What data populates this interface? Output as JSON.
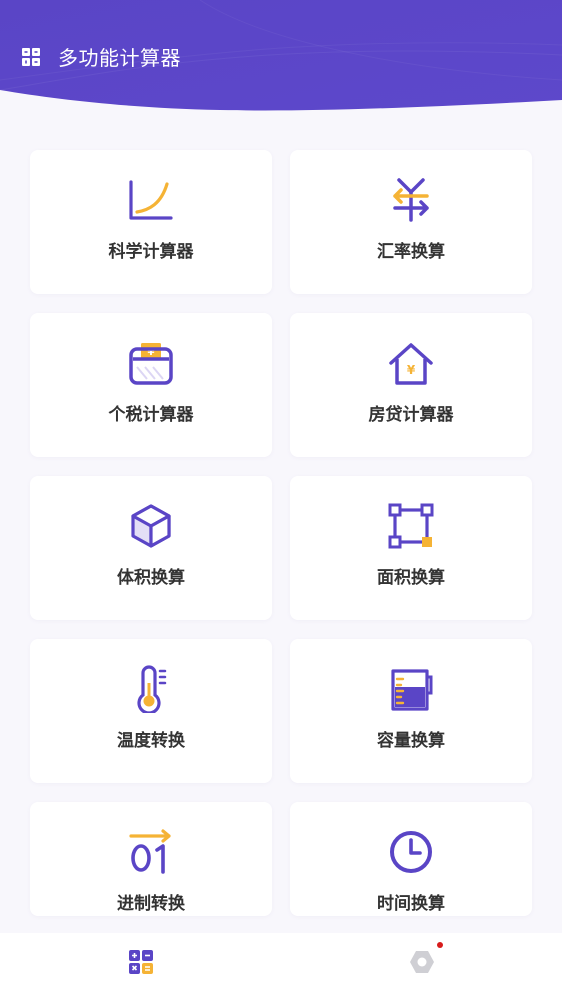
{
  "header": {
    "title": "多功能计算器",
    "icon": "grid-apps-icon"
  },
  "theme": {
    "primary": "#5a45c6",
    "accent": "#f5b335"
  },
  "tools": [
    {
      "label": "科学计算器",
      "icon": "curve-chart-icon"
    },
    {
      "label": "汇率换算",
      "icon": "yen-exchange-icon"
    },
    {
      "label": "个税计算器",
      "icon": "wallet-yen-icon"
    },
    {
      "label": "房贷计算器",
      "icon": "house-yen-icon"
    },
    {
      "label": "体积换算",
      "icon": "cube-icon"
    },
    {
      "label": "面积换算",
      "icon": "square-area-icon"
    },
    {
      "label": "温度转换",
      "icon": "thermometer-icon"
    },
    {
      "label": "容量换算",
      "icon": "beaker-icon"
    },
    {
      "label": "进制转换",
      "icon": "binary-arrow-icon"
    },
    {
      "label": "时间换算",
      "icon": "clock-icon"
    }
  ],
  "bottom_nav": [
    {
      "name": "calculators",
      "icon": "calculator-grid-icon",
      "active": true
    },
    {
      "name": "settings",
      "icon": "settings-hexagon-icon",
      "active": false,
      "badge": true
    }
  ]
}
